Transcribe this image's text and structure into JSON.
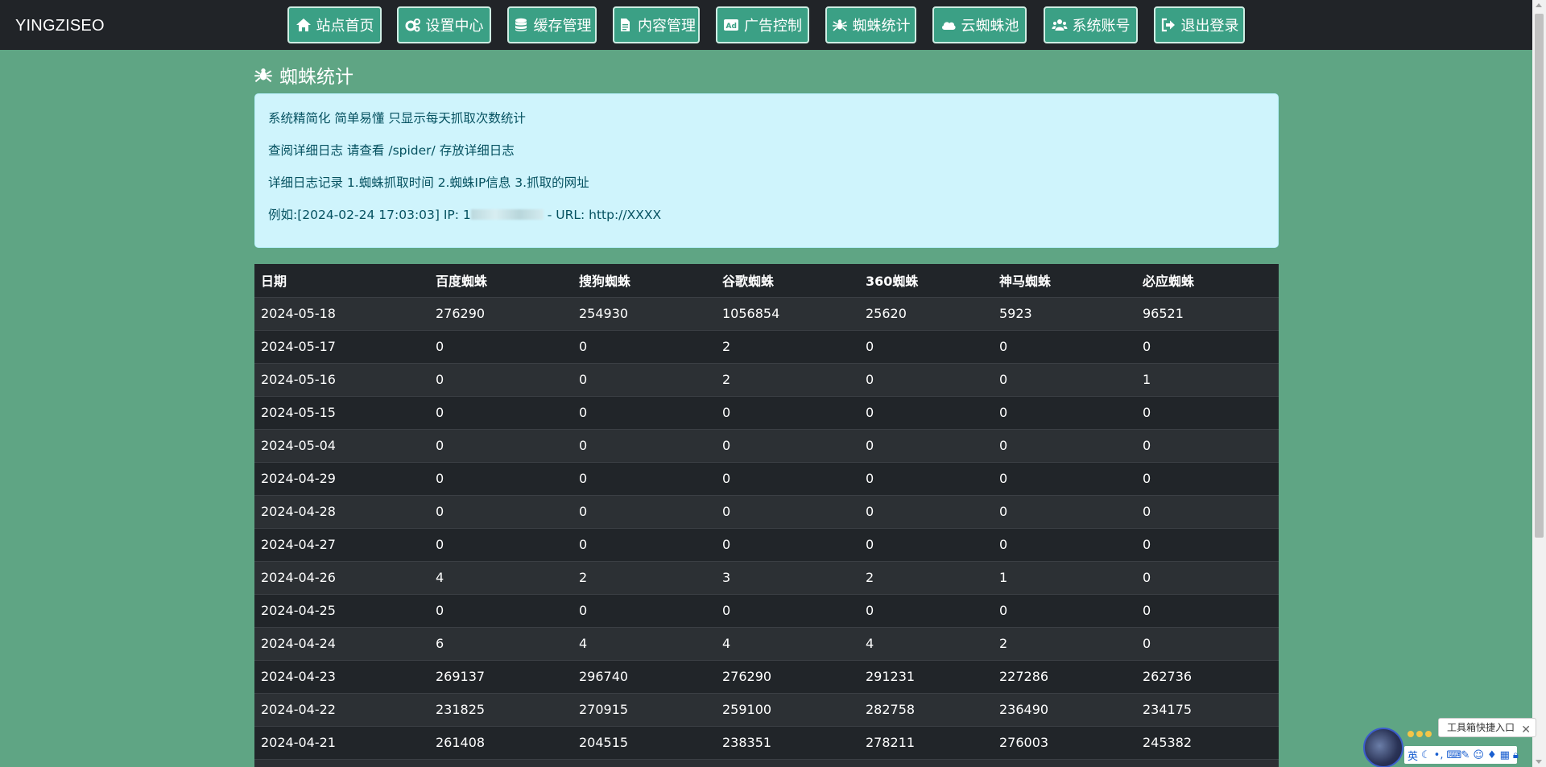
{
  "brand": "YINGZISEO",
  "nav": [
    {
      "label": "站点首页",
      "icon": "home-icon"
    },
    {
      "label": "设置中心",
      "icon": "gears-icon"
    },
    {
      "label": "缓存管理",
      "icon": "database-icon"
    },
    {
      "label": "内容管理",
      "icon": "file-icon"
    },
    {
      "label": "广告控制",
      "icon": "ad-icon"
    },
    {
      "label": "蜘蛛统计",
      "icon": "spider-icon"
    },
    {
      "label": "云蜘蛛池",
      "icon": "cloud-icon"
    },
    {
      "label": "系统账号",
      "icon": "users-icon"
    },
    {
      "label": "退出登录",
      "icon": "logout-icon"
    }
  ],
  "page_title": "蜘蛛统计",
  "info": {
    "line1": "系统精简化  简单易懂  只显示每天抓取次数统计",
    "line2": "查阅详细日志  请查看  /spider/  存放详细日志",
    "line3": "详细日志记录  1.蜘蛛抓取时间  2.蜘蛛IP信息  3.抓取的网址",
    "line4_prefix": "例如:[2024-02-24 17:03:03] IP: 1",
    "line4_suffix": " - URL: http://XXXX"
  },
  "table": {
    "headers": [
      "日期",
      "百度蜘蛛",
      "搜狗蜘蛛",
      "谷歌蜘蛛",
      "360蜘蛛",
      "神马蜘蛛",
      "必应蜘蛛"
    ],
    "rows": [
      [
        "2024-05-18",
        "276290",
        "254930",
        "1056854",
        "25620",
        "5923",
        "96521"
      ],
      [
        "2024-05-17",
        "0",
        "0",
        "2",
        "0",
        "0",
        "0"
      ],
      [
        "2024-05-16",
        "0",
        "0",
        "2",
        "0",
        "0",
        "1"
      ],
      [
        "2024-05-15",
        "0",
        "0",
        "0",
        "0",
        "0",
        "0"
      ],
      [
        "2024-05-04",
        "0",
        "0",
        "0",
        "0",
        "0",
        "0"
      ],
      [
        "2024-04-29",
        "0",
        "0",
        "0",
        "0",
        "0",
        "0"
      ],
      [
        "2024-04-28",
        "0",
        "0",
        "0",
        "0",
        "0",
        "0"
      ],
      [
        "2024-04-27",
        "0",
        "0",
        "0",
        "0",
        "0",
        "0"
      ],
      [
        "2024-04-26",
        "4",
        "2",
        "3",
        "2",
        "1",
        "0"
      ],
      [
        "2024-04-25",
        "0",
        "0",
        "0",
        "0",
        "0",
        "0"
      ],
      [
        "2024-04-24",
        "6",
        "4",
        "4",
        "4",
        "2",
        "0"
      ],
      [
        "2024-04-23",
        "269137",
        "296740",
        "276290",
        "291231",
        "227286",
        "262736"
      ],
      [
        "2024-04-22",
        "231825",
        "270915",
        "259100",
        "282758",
        "236490",
        "234175"
      ],
      [
        "2024-04-21",
        "261408",
        "204515",
        "238351",
        "278211",
        "276003",
        "245382"
      ],
      [
        "",
        "",
        "",
        "",
        "",
        "",
        ""
      ]
    ]
  },
  "overlay": {
    "toolbox_tip": "工具箱快捷入口",
    "close": "✕",
    "ime_lang": "英"
  },
  "colors": {
    "background": "#5fa584",
    "topbar": "#212428",
    "nav_button": "#3ba085",
    "info_bg": "#cff4fc",
    "table_dark": "#212529",
    "table_stripe": "#2c3034"
  }
}
